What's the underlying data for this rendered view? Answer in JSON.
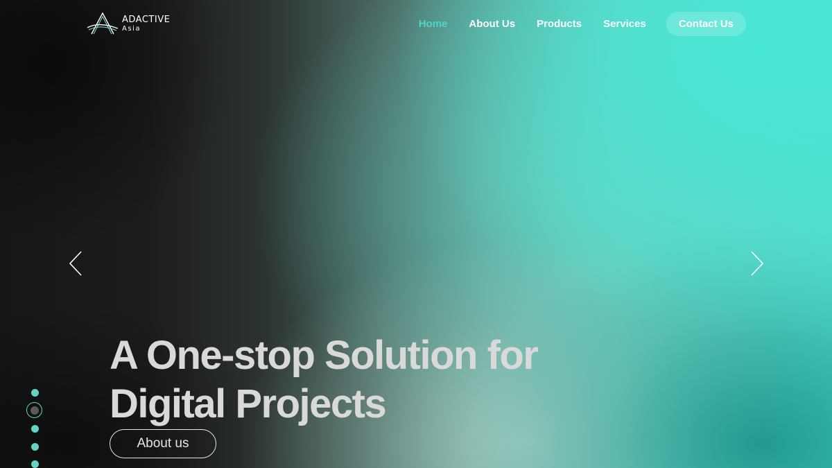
{
  "brand": {
    "name": "ADACTIVE",
    "subtitle": "Asia",
    "icon": "adactive-a-logo-icon"
  },
  "nav": {
    "items": [
      {
        "label": "Home",
        "active": true
      },
      {
        "label": "About Us",
        "active": false
      },
      {
        "label": "Products",
        "active": false
      },
      {
        "label": "Services",
        "active": false
      },
      {
        "label": "Contact Us",
        "active": false
      }
    ]
  },
  "hero": {
    "headline_line1": "A One-stop Solution for",
    "headline_line2": "Digital Projects",
    "cta_label": "About us",
    "prev_icon": "chevron-left-icon",
    "next_icon": "chevron-right-icon"
  },
  "slider": {
    "dot_count": 5,
    "active_index": 1
  },
  "colors": {
    "accent": "#52d3c4",
    "headline": "#d9d9d9",
    "dark": "#161616"
  }
}
